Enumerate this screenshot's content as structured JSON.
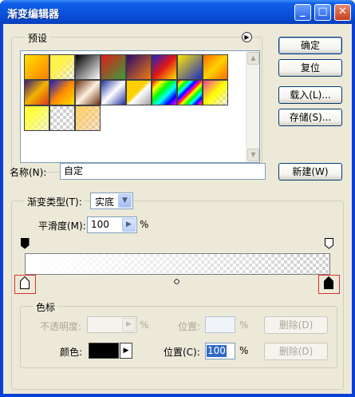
{
  "window": {
    "title": "渐变编辑器",
    "minimize": "_",
    "maximize": "□",
    "close": "✕"
  },
  "presets": {
    "label": "预设",
    "menu_icon": "circle-arrow-right-icon",
    "swatches": [
      {
        "bg": "linear-gradient(135deg,#ffe200,#ff7e00)"
      },
      {
        "bg": "linear-gradient(135deg,#fff24a,#fff24a 40%,rgba(255,255,255,0))",
        "checker": true
      },
      {
        "bg": "linear-gradient(135deg,#000,#fff)"
      },
      {
        "bg": "linear-gradient(135deg,#e01b1b,#3a9f3a)"
      },
      {
        "bg": "linear-gradient(135deg,#2a0a6a,#f07a12)"
      },
      {
        "bg": "linear-gradient(135deg,#1d22c9,#e01616,#ffe300)"
      },
      {
        "bg": "linear-gradient(135deg,#ffe600,#1b2dc9)"
      },
      {
        "bg": "linear-gradient(135deg,#ff6a00,#ffd200,#ff6a00)"
      },
      {
        "bg": "linear-gradient(135deg,#3a1a7a,#f2b300,#d83a1a)"
      },
      {
        "bg": "linear-gradient(135deg,#1a1ac9,#ff8a00,#ffe000)"
      },
      {
        "bg": "linear-gradient(135deg,#6b3010,#fff0e0,#6b3010)"
      },
      {
        "bg": "linear-gradient(135deg,#2030a0,#fff,#2030a0)"
      },
      {
        "bg": "linear-gradient(135deg,#ffd000,#ffd000 45%,#fff 55%,#a0a0a0)"
      },
      {
        "bg": "linear-gradient(135deg,#f00,#ff0,#0f0,#0ff,#00f,#f0f)"
      },
      {
        "bg": "repeating-linear-gradient(135deg,#f00 0,#ff0 4px,#0f0 8px,#0ff 12px,#00f 16px,#f0f 20px)"
      },
      {
        "bg": "linear-gradient(135deg,#f040a0,#ff0 50%,#fff0 100%)",
        "checker": true
      },
      {
        "bg": "linear-gradient(135deg,#ffff40,#ffff40 30%,rgba(255,255,150,0.4))",
        "checker": true
      },
      {
        "bg": "linear-gradient(135deg,rgba(255,255,255,0),rgba(255,255,255,0))",
        "checker": true
      },
      {
        "bg": "linear-gradient(135deg,#ffd060,rgba(255,180,100,0.3))",
        "checker": true
      }
    ]
  },
  "buttons": {
    "ok": "确定",
    "reset": "复位",
    "load": "载入(L)...",
    "save": "存储(S)...",
    "new": "新建(W)",
    "delete_opacity": "删除(D)",
    "delete_color": "删除(D)"
  },
  "name": {
    "label": "名称(N):",
    "value": "自定"
  },
  "gradient_type": {
    "label": "渐变类型(T):",
    "value": "实底"
  },
  "smoothness": {
    "label": "平滑度(M):",
    "value": "100",
    "unit": "%"
  },
  "stops": {
    "label": "色标",
    "opacity_label": "不透明度:",
    "opacity_unit": "%",
    "opacity_location_label": "位置:",
    "opacity_location_unit": "%",
    "color_label": "颜色:",
    "color_value": "#000000",
    "color_location_label": "位置(C):",
    "color_location_value": "100",
    "color_location_unit": "%"
  }
}
